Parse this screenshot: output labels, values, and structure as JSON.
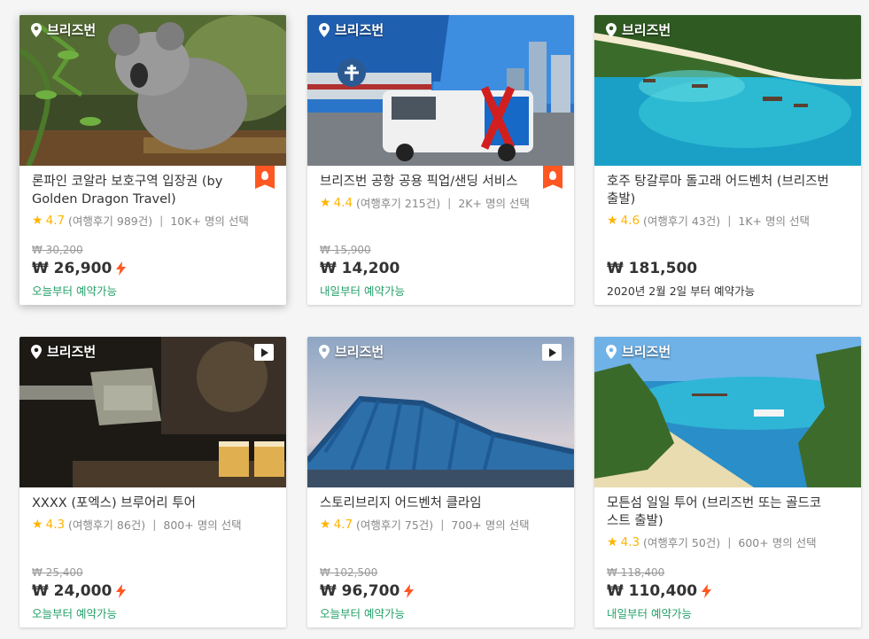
{
  "colors": {
    "accent_orange": "#ff5722",
    "star": "#ffb400",
    "green": "#25a06a"
  },
  "cards": [
    {
      "location": "브리즈번",
      "title": "론파인 코알라 보호구역 입장권 (by Golden Dragon Travel)",
      "rating": "4.7",
      "reviews": "(여행후기 989건)",
      "chosen": "10K+ 명의 선택",
      "original_price": "₩ 30,200",
      "price": "₩ 26,900",
      "instant": true,
      "availability": "오늘부터 예약가능",
      "badge": "hot-badge-icon"
    },
    {
      "location": "브리즈번",
      "title": "브리즈번 공항 공용 픽업/샌딩 서비스",
      "rating": "4.4",
      "reviews": "(여행후기 215건)",
      "chosen": "2K+ 명의 선택",
      "original_price": "₩ 15,900",
      "price": "₩ 14,200",
      "instant": false,
      "availability": "내일부터 예약가능",
      "badge": "hot-badge-icon"
    },
    {
      "location": "브리즈번",
      "title": "호주 탕갈루마 돌고래 어드벤처 (브리즈번 출발)",
      "rating": "4.6",
      "reviews": "(여행후기 43건)",
      "chosen": "1K+ 명의 선택",
      "original_price": "",
      "price": "₩ 181,500",
      "instant": false,
      "availability": "2020년 2월 2일 부터 예약가능"
    },
    {
      "location": "브리즈번",
      "title": "XXXX (포엑스) 브루어리 투어",
      "rating": "4.3",
      "reviews": "(여행후기 86건)",
      "chosen": "800+ 명의 선택",
      "original_price": "₩ 25,400",
      "price": "₩ 24,000",
      "instant": true,
      "availability": "오늘부터 예약가능",
      "media": "play-icon"
    },
    {
      "location": "브리즈번",
      "title": "스토리브리지 어드벤처 클라임",
      "rating": "4.7",
      "reviews": "(여행후기 75건)",
      "chosen": "700+ 명의 선택",
      "original_price": "₩ 102,500",
      "price": "₩ 96,700",
      "instant": true,
      "availability": "오늘부터 예약가능",
      "media": "play-icon"
    },
    {
      "location": "브리즈번",
      "title": "모튼섬 일일 투어 (브리즈번 또는 골드코스트 출발)",
      "rating": "4.3",
      "reviews": "(여행후기 50건)",
      "chosen": "600+ 명의 선택",
      "original_price": "₩ 118,400",
      "price": "₩ 110,400",
      "instant": true,
      "availability": "내일부터 예약가능"
    }
  ]
}
